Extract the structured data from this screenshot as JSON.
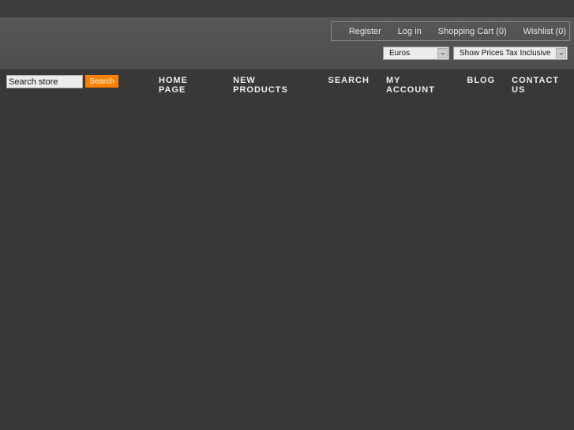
{
  "header": {
    "links": [
      "Register",
      "Log in",
      "Shopping Cart (0)",
      "Wishlist (0)"
    ],
    "currency": "Euros",
    "tax_display": "Show Prices Tax Inclusive"
  },
  "search": {
    "value": "Search store",
    "button_label": "Search",
    "button_color": "#ff8000"
  },
  "menu": [
    "HOME PAGE",
    "NEW PRODUCTS",
    "SEARCH",
    "MY ACCOUNT",
    "BLOG",
    "CONTACT US"
  ]
}
